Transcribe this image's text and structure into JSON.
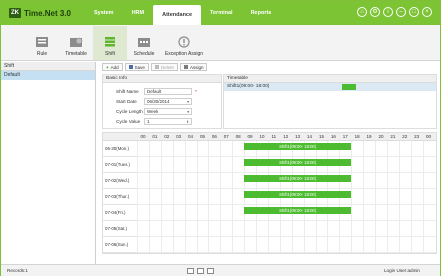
{
  "app": {
    "logo_mark": "ZK",
    "title": "Time.Net 3.0"
  },
  "nav": [
    {
      "label": "System",
      "active": false
    },
    {
      "label": "HRM",
      "active": false
    },
    {
      "label": "Attendance",
      "active": true
    },
    {
      "label": "Terminal",
      "active": false
    },
    {
      "label": "Reports",
      "active": false
    }
  ],
  "window_controls": [
    "home-icon",
    "settings-icon",
    "info-icon",
    "minimize-icon",
    "restore-icon",
    "close-icon"
  ],
  "toolbar": [
    {
      "label": "Rule",
      "icon": "rule-icon",
      "active": false
    },
    {
      "label": "Timetable",
      "icon": "timetable-icon",
      "active": false
    },
    {
      "label": "Shift",
      "icon": "shift-icon",
      "active": true
    },
    {
      "label": "Schedule",
      "icon": "schedule-icon",
      "active": false
    },
    {
      "label": "Exception Assign",
      "icon": "exception-assign-icon",
      "active": false
    }
  ],
  "left_panel": {
    "header": "Shift",
    "items": [
      "Default"
    ],
    "selected": "Default"
  },
  "actions": {
    "add": "Add",
    "save": "Save",
    "delete": "Delete",
    "assign": "Assign"
  },
  "basic_info": {
    "title": "Basic Info",
    "shift_name_label": "Shift Name",
    "shift_name_value": "Default",
    "start_date_label": "Start Date",
    "start_date_value": "06/30/2014",
    "cycle_length_label": "Cycle Length",
    "cycle_length_value": "Week",
    "cycle_value_label": "Cycle Value",
    "cycle_value_value": "1"
  },
  "timetable": {
    "title": "Timetable",
    "entry": "Shift1(09:00- 18:00)"
  },
  "grid": {
    "hours": [
      "00",
      "01",
      "02",
      "03",
      "04",
      "05",
      "06",
      "07",
      "08",
      "09",
      "10",
      "11",
      "12",
      "13",
      "14",
      "15",
      "16",
      "17",
      "18",
      "19",
      "20",
      "21",
      "22",
      "23",
      "00"
    ],
    "days": [
      {
        "label": "06-30(Mon.)",
        "shift": "Shift1(09:00- 18:00)"
      },
      {
        "label": "07-01(Tues.)",
        "shift": "Shift1(09:00- 18:00)"
      },
      {
        "label": "07-02(Wed.)",
        "shift": "Shift1(09:00- 18:00)"
      },
      {
        "label": "07-03(Thur.)",
        "shift": "Shift1(09:00- 18:00)"
      },
      {
        "label": "07-04(Fri.)",
        "shift": "Shift1(09:00- 18:00)"
      },
      {
        "label": "07-05(Sat.)",
        "shift": null
      },
      {
        "label": "07-06(Sun.)",
        "shift": null
      }
    ],
    "shift_start_hour": 9,
    "shift_end_hour": 18
  },
  "status": {
    "records": "Records:1",
    "login": "Login User:admin"
  },
  "colors": {
    "brand": "#7cc433",
    "bar": "#4cbb2f",
    "selection": "#c6e0f3"
  }
}
